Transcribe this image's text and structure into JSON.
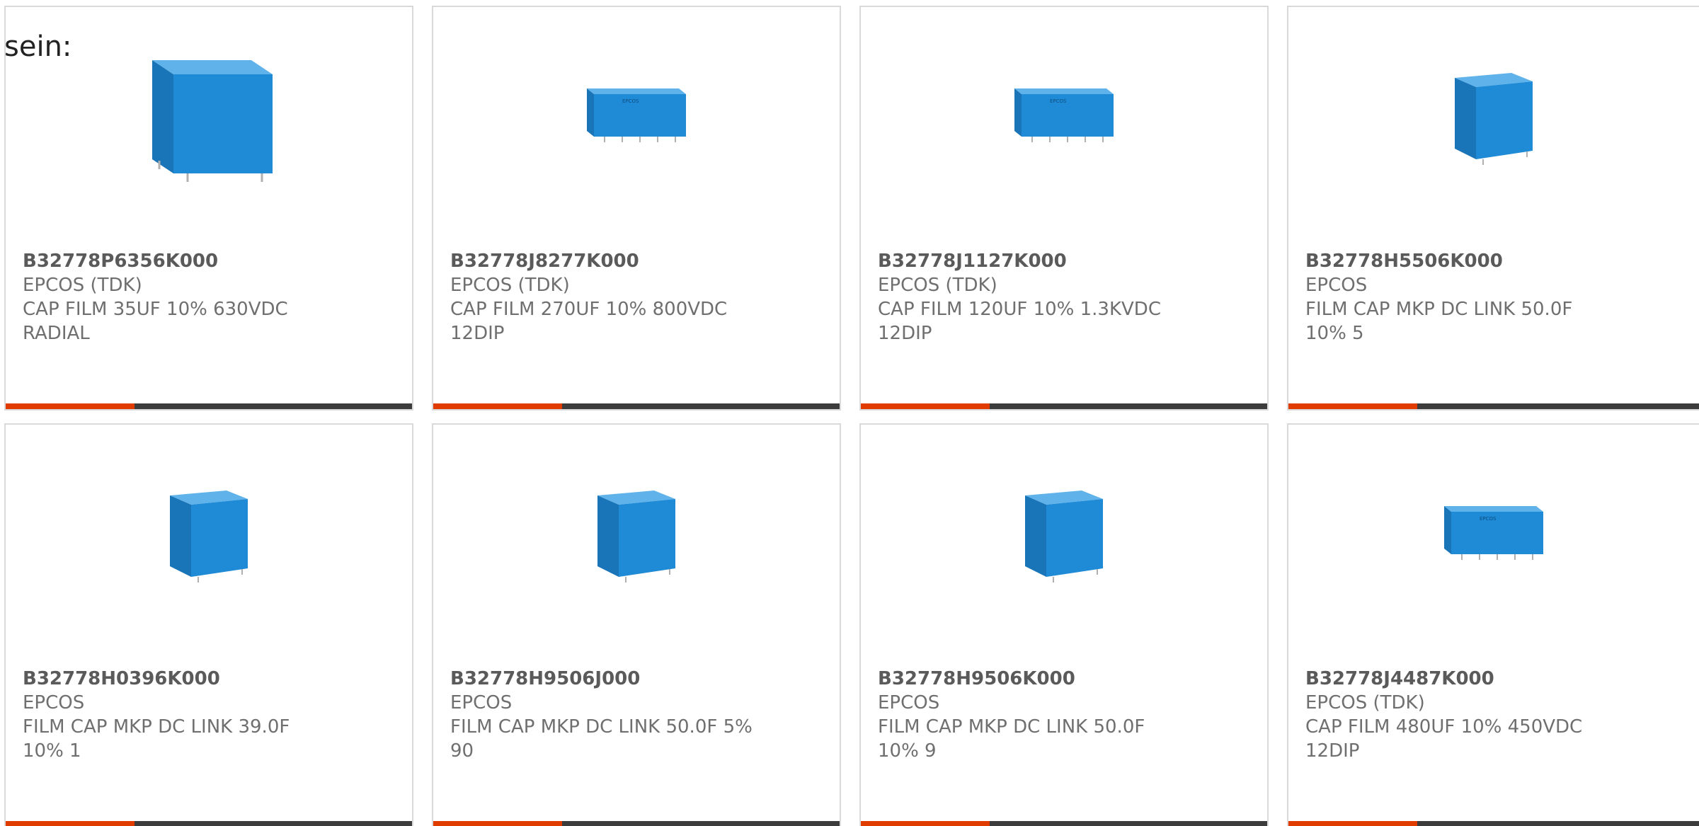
{
  "intro_text": "sein:",
  "colors": {
    "capacitor_body": "#1f8ad6",
    "capacitor_top": "#4aa9ea",
    "capacitor_side": "#176fb2",
    "accent_bar": "#e03c00",
    "dark_bar": "#3c3c3c"
  },
  "products": [
    {
      "part_number": "B32778P6356K000",
      "manufacturer": "EPCOS (TDK)",
      "description_line1": "CAP FILM 35UF 10% 630VDC",
      "description_line2": "RADIAL",
      "image_icon": "capacitor-large-icon"
    },
    {
      "part_number": "B32778J8277K000",
      "manufacturer": "EPCOS (TDK)",
      "description_line1": "CAP FILM 270UF 10% 800VDC",
      "description_line2": "12DIP",
      "image_icon": "capacitor-wide-icon"
    },
    {
      "part_number": "B32778J1127K000",
      "manufacturer": "EPCOS (TDK)",
      "description_line1": "CAP FILM 120UF 10% 1.3KVDC",
      "description_line2": "12DIP",
      "image_icon": "capacitor-wide-icon"
    },
    {
      "part_number": "B32778H5506K000",
      "manufacturer": "EPCOS",
      "description_line1": "FILM CAP MKP DC LINK 50.0F",
      "description_line2": "10% 5",
      "image_icon": "capacitor-cube-icon"
    },
    {
      "part_number": "B32778H0396K000",
      "manufacturer": "EPCOS",
      "description_line1": "FILM CAP MKP DC LINK 39.0F",
      "description_line2": "10% 1",
      "image_icon": "capacitor-cube-icon"
    },
    {
      "part_number": "B32778H9506J000",
      "manufacturer": "EPCOS",
      "description_line1": "FILM CAP MKP DC LINK 50.0F 5%",
      "description_line2": "90",
      "image_icon": "capacitor-cube-icon"
    },
    {
      "part_number": "B32778H9506K000",
      "manufacturer": "EPCOS",
      "description_line1": "FILM CAP MKP DC LINK 50.0F",
      "description_line2": "10% 9",
      "image_icon": "capacitor-cube-icon"
    },
    {
      "part_number": "B32778J4487K000",
      "manufacturer": "EPCOS (TDK)",
      "description_line1": "CAP FILM 480UF 10% 450VDC",
      "description_line2": "12DIP",
      "image_icon": "capacitor-wide-icon"
    }
  ]
}
